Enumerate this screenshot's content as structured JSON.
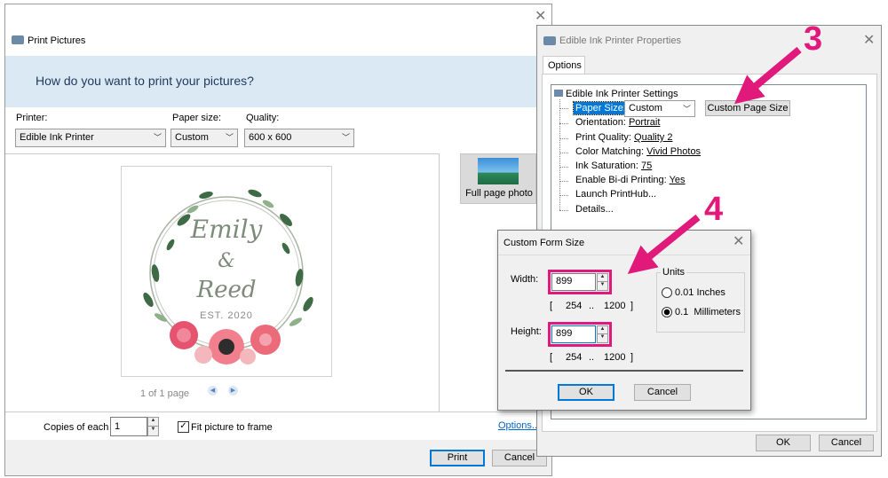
{
  "print_pictures": {
    "title": "Print Pictures",
    "banner": "How do you want to print your pictures?",
    "printer_label": "Printer:",
    "printer_value": "Edible Ink Printer",
    "paper_label": "Paper size:",
    "paper_value": "Custom",
    "quality_label": "Quality:",
    "quality_value": "600 x 600",
    "preview": {
      "line1": "Emily",
      "line2": "&",
      "line3": "Reed",
      "line4": "EST. 2020"
    },
    "page_indicator": "1 of 1 page",
    "layout_label": "Full page photo",
    "copies_label": "Copies of each",
    "copies_value": "1",
    "fit_label": "Fit picture to frame",
    "options_link": "Options...",
    "print_button": "Print",
    "cancel_button": "Cancel"
  },
  "properties": {
    "title": "Edible Ink Printer Properties",
    "tab": "Options",
    "root": "Edible Ink Printer Settings",
    "paper_size_label": "Paper Size:",
    "paper_size_value": "Custom",
    "custom_page_button": "Custom Page Size",
    "orientation_label": "Orientation:",
    "orientation_value": "Portrait",
    "print_quality_label": "Print Quality:",
    "print_quality_value": "Quality 2",
    "color_matching_label": "Color Matching:",
    "color_matching_value": "Vivid Photos",
    "ink_saturation_label": "Ink Saturation:",
    "ink_saturation_value": "75",
    "bidi_label": "Enable Bi-di Printing:",
    "bidi_value": "Yes",
    "launch": "Launch PrintHub...",
    "details": "Details...",
    "ok_button": "OK",
    "cancel_button": "Cancel"
  },
  "custom_form": {
    "title": "Custom Form Size",
    "width_label": "Width:",
    "width_value": "899",
    "width_min": "254",
    "width_dots": "..",
    "width_max": "1200",
    "height_label": "Height:",
    "height_value": "899",
    "height_min": "254",
    "height_dots": "..",
    "height_max": "1200",
    "bracket_open": "[",
    "bracket_close": "]",
    "units_label": "Units",
    "unit_inches": "0.01 Inches",
    "unit_mm": "0.1  Millimeters",
    "ok_button": "OK",
    "cancel_button": "Cancel"
  },
  "annotations": {
    "step3": "3",
    "step4": "4",
    "color": "#e0197a"
  },
  "colors": {
    "banner_bg": "#dbe9f5",
    "selection": "#0078d7"
  }
}
